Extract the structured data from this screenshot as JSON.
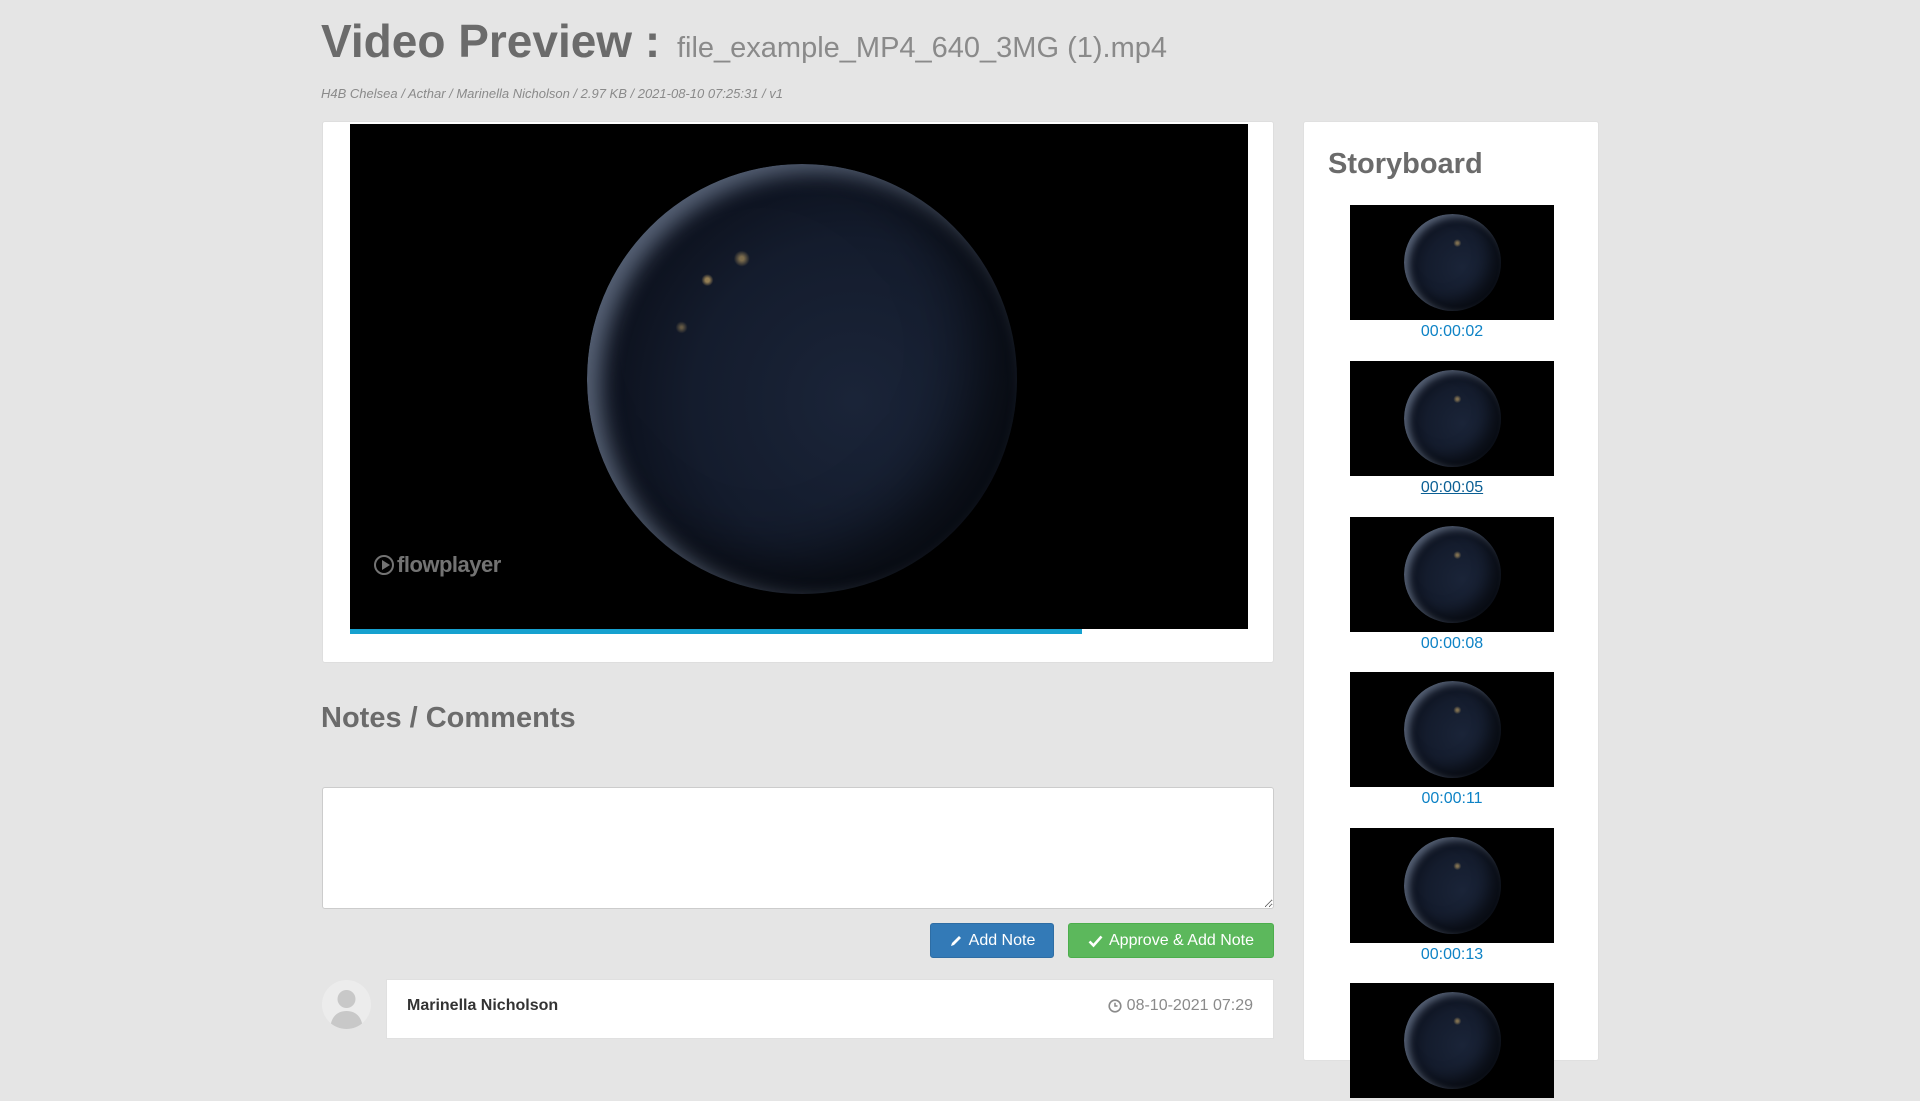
{
  "header": {
    "title": "Video Preview :",
    "filename": "file_example_MP4_640_3MG (1).mp4",
    "meta": "H4B Chelsea / Acthar / Marinella Nicholson / 2.97 KB / 2021-08-10 07:25:31 / v1"
  },
  "player": {
    "brand": "flowplayer",
    "progress_percent": 81.5,
    "progress_color": "#16a1cf"
  },
  "notes": {
    "title": "Notes / Comments",
    "input_value": "",
    "add_note_label": "Add Note",
    "approve_label": "Approve & Add Note"
  },
  "comments": [
    {
      "author": "Marinella Nicholson",
      "timestamp": "08-10-2021 07:29"
    }
  ],
  "storyboard": {
    "title": "Storyboard",
    "items": [
      {
        "time": "00:00:02"
      },
      {
        "time": "00:00:05",
        "underlined": true
      },
      {
        "time": "00:00:08"
      },
      {
        "time": "00:00:11"
      },
      {
        "time": "00:00:13"
      },
      {
        "time": ""
      }
    ]
  },
  "colors": {
    "add_note": "#337ab7",
    "approve": "#5cb85c",
    "link": "#0e83c6"
  },
  "icons": {
    "add_note": "pencil-icon",
    "approve": "check-icon",
    "timestamp": "clock-icon",
    "avatar": "user-avatar-icon",
    "brand": "play-circle-icon"
  }
}
